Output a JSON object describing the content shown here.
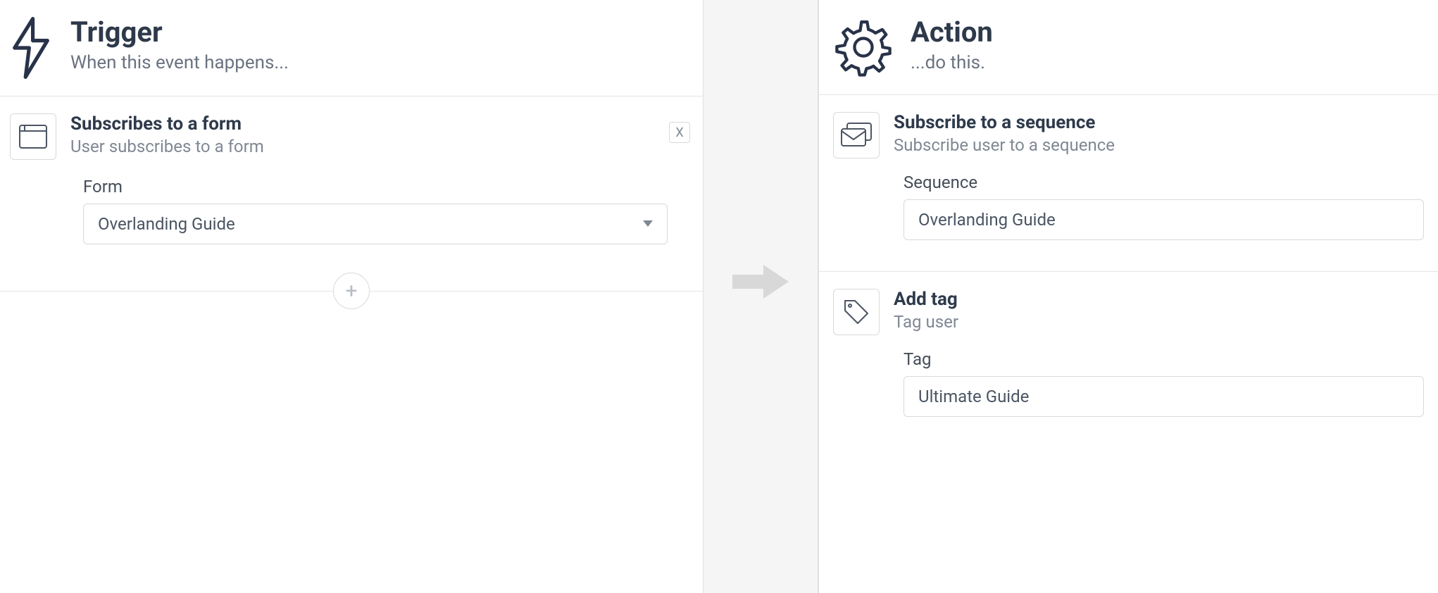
{
  "trigger": {
    "title": "Trigger",
    "subtitle": "When this event happens...",
    "card": {
      "title": "Subscribes to a form",
      "subtitle": "User subscribes to a form",
      "close_label": "X",
      "field_label": "Form",
      "field_value": "Overlanding Guide"
    },
    "add_label": "+"
  },
  "action": {
    "title": "Action",
    "subtitle": "...do this.",
    "cards": [
      {
        "title": "Subscribe to a sequence",
        "subtitle": "Subscribe user to a sequence",
        "field_label": "Sequence",
        "field_value": "Overlanding Guide"
      },
      {
        "title": "Add tag",
        "subtitle": "Tag user",
        "field_label": "Tag",
        "field_value": "Ultimate Guide"
      }
    ]
  }
}
